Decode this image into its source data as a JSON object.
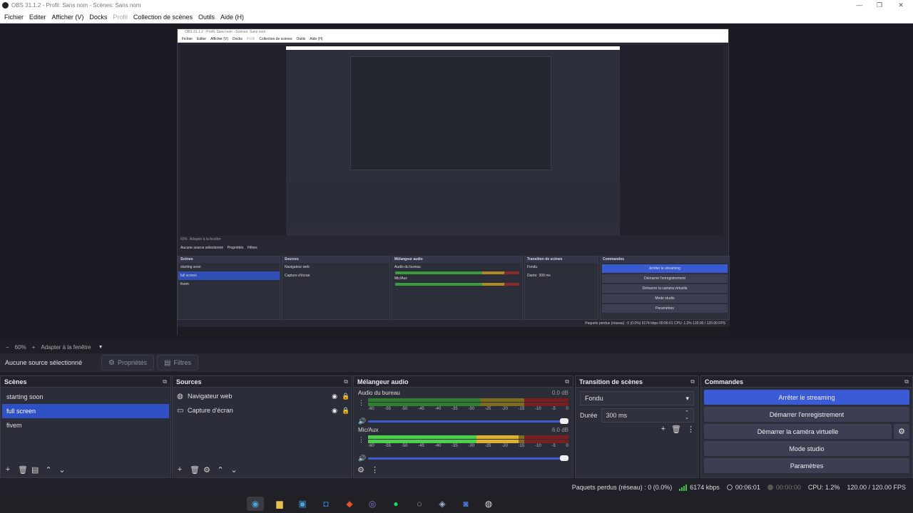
{
  "window": {
    "title": "OBS 31.1.2 - Profil: Sans nom - Scènes: Sans nom",
    "minimize": "—",
    "maximize": "❐",
    "close": "✕"
  },
  "menu": [
    "Fichier",
    "Editer",
    "Afficher (V)",
    "Docks",
    "Profil",
    "Collection de scènes",
    "Outils",
    "Aide (H)"
  ],
  "nested": {
    "title": "OBS 31.1.2 - Profil: Sans nom - Scènes: Sans nom",
    "menu": [
      "Fichier",
      "Editer",
      "Afficher (V)",
      "Docks",
      "Profil",
      "Collection de scènes",
      "Outils",
      "Aide (H)"
    ],
    "zoom": "60%",
    "fit": "Adapter à la fenêtre",
    "no_source": "Aucune source sélectionné",
    "properties": "Propriétés",
    "filters": "Filtres",
    "scenes_title": "Scènes",
    "sources_title": "Sources",
    "mixer_title": "Mélangeur audio",
    "transitions_title": "Transition de scènes",
    "commands_title": "Commandes",
    "scenes": [
      "starting soon",
      "full screen",
      "fivem"
    ],
    "sources": [
      "Navigateur web",
      "Capture d'écran"
    ],
    "ch1": "Audio du bureau",
    "ch2": "Mic/Aux",
    "transition": "Fondu",
    "duration_label": "Durée",
    "duration": "300 ms",
    "commands": [
      "Arrêter le streaming",
      "Démarrer l'enregistrement",
      "Démarrer la caméra virtuelle",
      "Mode studio",
      "Paramètres"
    ],
    "status": "Paquets perdus (réseau) : 0 (0.0%)   6174 kbps   00:06:01   CPU: 1.2%   120.00 / 120.00 FPS"
  },
  "zoom": {
    "minus": "−",
    "value": "60%",
    "plus": "+",
    "fit": "Adapter à la fenêtre",
    "caret": "▼"
  },
  "source_bar": {
    "no_source": "Aucune source sélectionné",
    "properties": "Propriétés",
    "filters": "Filtres"
  },
  "scenes": {
    "title": "Scènes",
    "items": [
      "starting soon",
      "full screen",
      "fivem"
    ],
    "selected_index": 1
  },
  "sources": {
    "title": "Sources",
    "items": [
      {
        "name": "Navigateur web",
        "icon": "globe-icon"
      },
      {
        "name": "Capture d'écran",
        "icon": "monitor-icon"
      }
    ]
  },
  "mixer": {
    "title": "Mélangeur audio",
    "scale": [
      "-60",
      "-55",
      "-50",
      "-45",
      "-40",
      "-35",
      "-30",
      "-25",
      "-20",
      "-15",
      "-10",
      "-5",
      "0"
    ],
    "channels": [
      {
        "name": "Audio du bureau",
        "db": "0.0 dB",
        "level": 0,
        "volume": 1.0
      },
      {
        "name": "Mic/Aux",
        "db": "6.0 dB",
        "level": 0.75,
        "volume": 1.0
      }
    ]
  },
  "transitions": {
    "title": "Transition de scènes",
    "selected": "Fondu",
    "duration_label": "Durée",
    "duration": "300 ms"
  },
  "commands": {
    "title": "Commandes",
    "stream": "Arrêter le streaming",
    "record": "Démarrer l'enregistrement",
    "virtualcam": "Démarrer la caméra virtuelle",
    "studio": "Mode studio",
    "settings": "Paramètres"
  },
  "status": {
    "dropped": "Paquets perdus (réseau) : 0 (0.0%)",
    "bitrate": "6174 kbps",
    "stream_time": "00:06:01",
    "rec_time": "00:00:00",
    "cpu": "CPU: 1.2%",
    "fps": "120.00 / 120.00 FPS"
  },
  "colors": {
    "accent": "#3b5bd6",
    "selection": "#2e50c4",
    "meter_green": "#4cd04c",
    "meter_yellow": "#e0b030",
    "meter_red": "#c03030"
  }
}
